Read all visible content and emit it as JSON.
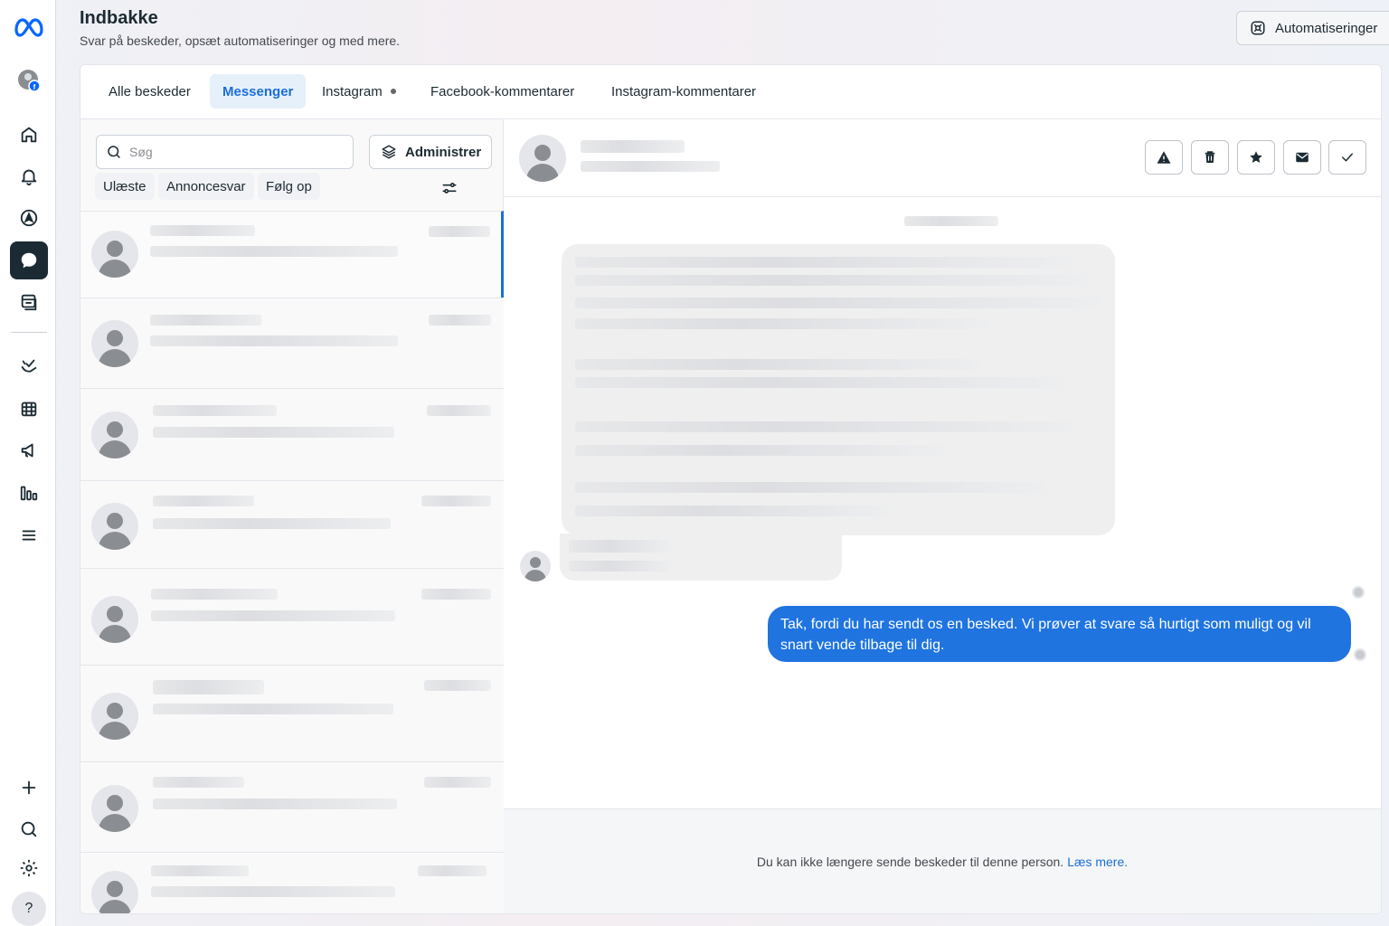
{
  "header": {
    "title": "Indbakke",
    "subtitle": "Svar på beskeder, opsæt automatiseringer og med mere.",
    "automations_label": "Automatiseringer"
  },
  "nav_rail": {
    "items": [
      {
        "icon": "meta-logo-icon"
      },
      {
        "icon": "profile-avatar-icon"
      },
      {
        "icon": "home-icon"
      },
      {
        "icon": "bell-icon"
      },
      {
        "icon": "compass-icon"
      },
      {
        "icon": "chat-bubble-icon",
        "active": true
      },
      {
        "icon": "content-icon"
      },
      {
        "icon": "recycle-hand-icon"
      },
      {
        "icon": "calendar-icon"
      },
      {
        "icon": "megaphone-icon"
      },
      {
        "icon": "insights-bars-icon"
      },
      {
        "icon": "menu-icon"
      },
      {
        "icon": "plus-icon"
      },
      {
        "icon": "search-icon"
      },
      {
        "icon": "gear-icon"
      },
      {
        "icon": "help-icon",
        "label": "?"
      }
    ]
  },
  "tabs": [
    {
      "label": "Alle beskeder",
      "active": false
    },
    {
      "label": "Messenger",
      "active": true
    },
    {
      "label": "Instagram",
      "active": false,
      "dot": true
    },
    {
      "label": "Facebook-kommentarer",
      "active": false
    },
    {
      "label": "Instagram-kommentarer",
      "active": false
    }
  ],
  "list": {
    "search_placeholder": "Søg",
    "manage_label": "Administrer",
    "filters": [
      "Ulæste",
      "Annoncesvar",
      "Følg op"
    ]
  },
  "chat": {
    "auto_reply": "Tak, fordi du har sendt os en besked. Vi prøver at svare så hurtigt som muligt og vil snart vende tilbage til dig.",
    "footer_text": "Du kan ikke længere sende beskeder til denne person.",
    "footer_link": "Læs mere."
  },
  "colors": {
    "accent": "#1a6ed8",
    "bubble": "#1f74e0",
    "rail_active": "#1c2b33"
  }
}
